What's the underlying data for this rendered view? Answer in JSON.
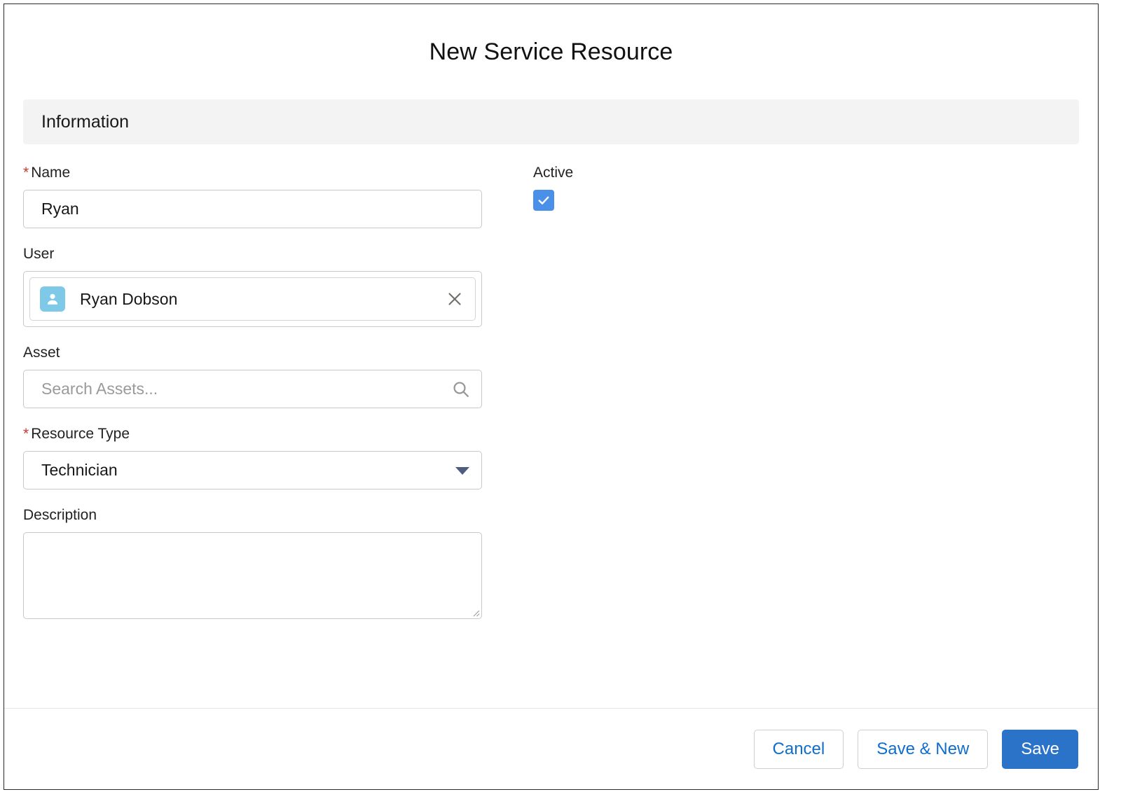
{
  "modal": {
    "title": "New Service Resource"
  },
  "section": {
    "header": "Information"
  },
  "fields": {
    "name": {
      "label": "Name",
      "required_marker": "*",
      "value": "Ryan"
    },
    "user": {
      "label": "User",
      "pill_label": "Ryan Dobson",
      "avatar_icon": "user-avatar-icon",
      "remove_icon": "close-icon"
    },
    "asset": {
      "label": "Asset",
      "value": "",
      "placeholder": "Search Assets...",
      "search_icon": "search-icon"
    },
    "resource_type": {
      "label": "Resource Type",
      "required_marker": "*",
      "value": "Technician",
      "dropdown_icon": "chevron-down-icon",
      "options": [
        "Technician"
      ]
    },
    "description": {
      "label": "Description",
      "value": ""
    },
    "active": {
      "label": "Active",
      "checked": true,
      "check_icon": "check-icon"
    }
  },
  "footer": {
    "cancel_label": "Cancel",
    "save_new_label": "Save & New",
    "save_label": "Save"
  },
  "colors": {
    "brand_blue": "#2b72c9",
    "link_blue": "#0f6ecd",
    "checkbox_blue": "#4a90e8",
    "avatar_blue": "#7dc9e7",
    "required_red": "#c23934",
    "section_gray": "#f3f3f3"
  }
}
